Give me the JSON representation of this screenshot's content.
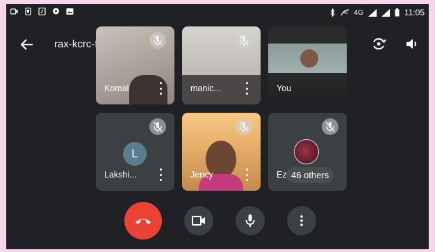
{
  "status_bar": {
    "network": "4G",
    "time": "11:05",
    "icons": [
      "screen-record-icon",
      "screenshot-icon",
      "data-saver-icon",
      "chat-bubble-icon",
      "gallery-icon",
      "bluetooth-icon",
      "volte-icon",
      "signal-icon",
      "signal-icon-2",
      "battery-icon"
    ]
  },
  "meeting": {
    "code": "rax-kcrc-fah"
  },
  "tiles": [
    {
      "name": "Komal"
    },
    {
      "name": "manic..."
    },
    {
      "name": "You"
    },
    {
      "name": "Lakshi...",
      "initial": "L"
    },
    {
      "name": "Jency"
    },
    {
      "name": "Ez",
      "others_label": "46 others"
    }
  ],
  "controls": {
    "buttons": [
      "end-call",
      "camera",
      "microphone",
      "more-options"
    ]
  },
  "colors": {
    "background": "#202124",
    "tile": "#3c4043",
    "end_call": "#ea4335",
    "frame": "#f6d6ea"
  }
}
